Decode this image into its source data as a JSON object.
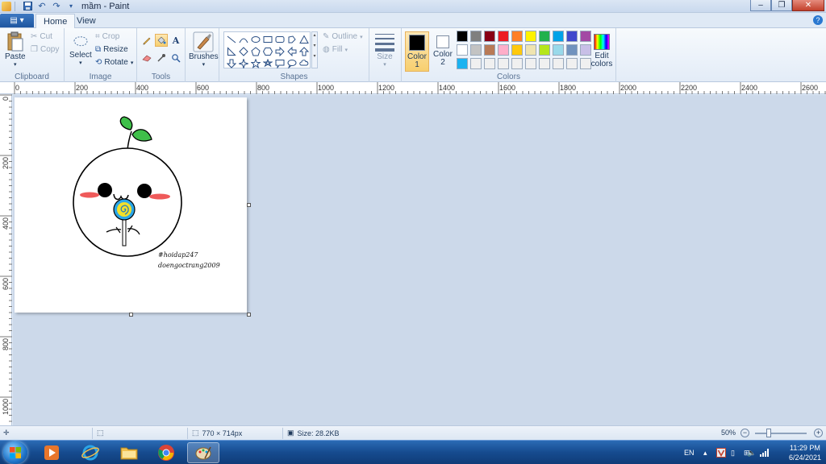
{
  "window": {
    "title": "mầm - Paint"
  },
  "tabs": {
    "file": "",
    "home": "Home",
    "view": "View"
  },
  "clipboard": {
    "paste": "Paste",
    "cut": "Cut",
    "copy": "Copy",
    "label": "Clipboard"
  },
  "image": {
    "select": "Select",
    "crop": "Crop",
    "resize": "Resize",
    "rotate": "Rotate",
    "label": "Image"
  },
  "tools": {
    "label": "Tools"
  },
  "brushes": {
    "label": "Brushes"
  },
  "shapes": {
    "outline": "Outline",
    "fill": "Fill",
    "label": "Shapes"
  },
  "size": {
    "label": "Size"
  },
  "colors": {
    "color1_label": "Color",
    "color1_num": "1",
    "color2_label": "Color",
    "color2_num": "2",
    "edit_label": "Edit",
    "edit_label2": "colors",
    "label": "Colors",
    "color1": "#000000",
    "color2": "#ffffff",
    "palette": [
      "#000000",
      "#7f7f7f",
      "#880015",
      "#ed1c24",
      "#ff7f27",
      "#fff200",
      "#22b14c",
      "#00a2e8",
      "#3f48cc",
      "#a349a4",
      "#ffffff",
      "#c3c3c3",
      "#b97a57",
      "#ffaec9",
      "#ffc90e",
      "#efe4b0",
      "#b5e61d",
      "#99d9ea",
      "#7092be",
      "#c8bfe7",
      "#1bb2f0",
      "#f0f0f0",
      "#f0f0f0",
      "#f0f0f0",
      "#f0f0f0",
      "#f0f0f0",
      "#f0f0f0",
      "#f0f0f0",
      "#f0f0f0",
      "#f0f0f0"
    ]
  },
  "ruler_h": [
    "0",
    "200",
    "400",
    "600",
    "800",
    "1000",
    "1200",
    "1400",
    "1600",
    "1800",
    "2000",
    "2200",
    "2400",
    "2600"
  ],
  "ruler_v": [
    "0",
    "200",
    "400",
    "600",
    "800",
    "1000"
  ],
  "drawing": {
    "line1": "#hoidap247",
    "line2": "doengoctrang2009"
  },
  "status": {
    "dimensions": "770 × 714px",
    "size": "Size: 28.2KB",
    "zoom": "50%"
  },
  "taskbar": {
    "lang": "EN",
    "time": "11:29 PM",
    "date": "6/24/2021"
  }
}
